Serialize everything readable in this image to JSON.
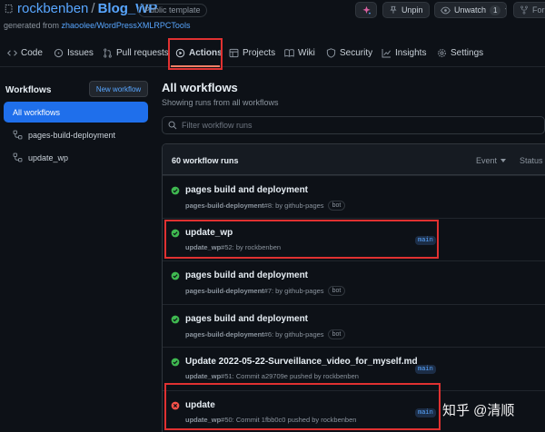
{
  "repo": {
    "owner": "rockbenben",
    "separator": "/",
    "name": "Blog_WP",
    "visibility_badge": "Public template",
    "generated_prefix": "generated from ",
    "generated_source": "zhaoolee/WordPressXMLRPCTools"
  },
  "header_buttons": {
    "unpin": "Unpin",
    "unwatch": "Unwatch",
    "watch_count": "1",
    "fork": "Fork"
  },
  "nav": {
    "tabs": [
      {
        "label": "Code",
        "icon": "code-icon"
      },
      {
        "label": "Issues",
        "icon": "issue-opened-icon"
      },
      {
        "label": "Pull requests",
        "icon": "git-pull-request-icon"
      },
      {
        "label": "Actions",
        "icon": "play-icon"
      },
      {
        "label": "Projects",
        "icon": "table-icon"
      },
      {
        "label": "Wiki",
        "icon": "book-icon"
      },
      {
        "label": "Security",
        "icon": "shield-icon"
      },
      {
        "label": "Insights",
        "icon": "graph-icon"
      },
      {
        "label": "Settings",
        "icon": "gear-icon"
      }
    ],
    "active_tab": "Actions"
  },
  "sidebar": {
    "title": "Workflows",
    "new_workflow_label": "New workflow",
    "items": [
      {
        "label": "All workflows"
      },
      {
        "label": "pages-build-deployment"
      },
      {
        "label": "update_wp"
      }
    ]
  },
  "main": {
    "title": "All workflows",
    "subtitle": "Showing runs from all workflows",
    "filter_placeholder": "Filter workflow runs",
    "runs_count_label": "60 workflow runs",
    "event_filter": "Event",
    "status_filter": "Status"
  },
  "runs": [
    {
      "status": "success",
      "title": "pages build and deployment",
      "workflow": "pages-build-deployment",
      "detail": " #8: by github-pages",
      "bot": "bot",
      "branch": ""
    },
    {
      "status": "success",
      "title": "update_wp",
      "workflow": "update_wp",
      "detail": " #52: by rockbenben",
      "bot": "",
      "branch": "main"
    },
    {
      "status": "success",
      "title": "pages build and deployment",
      "workflow": "pages-build-deployment",
      "detail": " #7: by github-pages",
      "bot": "bot",
      "branch": ""
    },
    {
      "status": "success",
      "title": "pages build and deployment",
      "workflow": "pages-build-deployment",
      "detail": " #6: by github-pages",
      "bot": "bot",
      "branch": ""
    },
    {
      "status": "success",
      "title": "Update 2022-05-22-Surveillance_video_for_myself.md",
      "workflow": "update_wp",
      "detail": " #51: Commit a29709e pushed by rockbenben",
      "bot": "",
      "branch": "main"
    },
    {
      "status": "failure",
      "title": "update",
      "workflow": "update_wp",
      "detail": " #50: Commit 1fbb0c0 pushed by rockbenben",
      "bot": "",
      "branch": "main"
    }
  ],
  "colors": {
    "background": "#0d1117",
    "accent": "#58a6ff",
    "selected": "#1f6feb",
    "success": "#3fb950",
    "failure": "#f85149",
    "highlight": "#e03131"
  },
  "watermark": "知乎 @清顺"
}
